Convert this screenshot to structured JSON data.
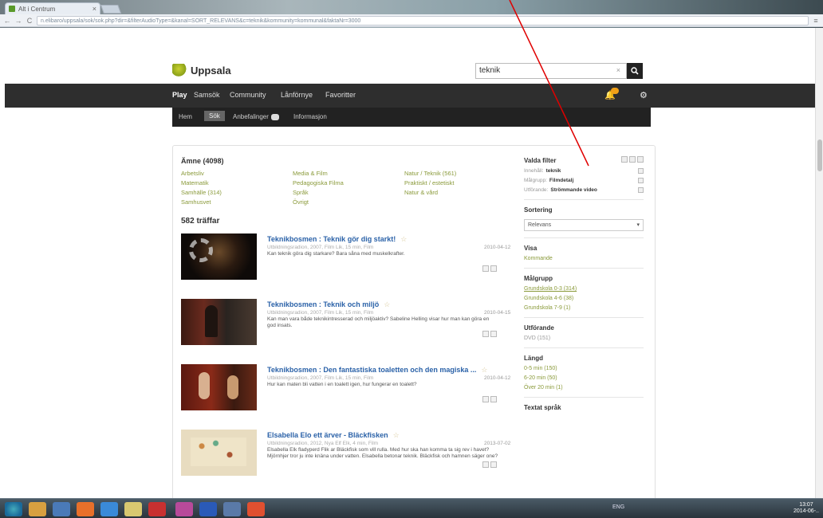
{
  "browser": {
    "tab_title": "Alt i Centrum",
    "tab_close": "×",
    "url": "n.elibaro/uppsala/sok/sok.php?dir=&filterAudioType=&kanal=SORT_RELEVANS&c=teknik&kommunity=kommunal&faktaNr=3000",
    "back": "←",
    "forward": "→",
    "reload": "C"
  },
  "header": {
    "logo_text": "Uppsala",
    "search_value": "teknik",
    "search_clear": "×",
    "search_icon": "magnifier-icon"
  },
  "nav": {
    "items": [
      "Play",
      "Samsök",
      "Community",
      "Lånförnye",
      "Favoritter"
    ],
    "subnav": [
      "Hem",
      "Sök",
      "Anbefalinger",
      "Informasjon"
    ],
    "notification_icon": "bell-icon",
    "settings_icon": "gear-icon"
  },
  "facets": {
    "heading": "Ämne (4098)",
    "items": [
      "Arbetsliv",
      "Media & Film",
      "Natur / Teknik (561)",
      "Matematik",
      "Pedagogiska Filma",
      "Praktiskt / estetiskt",
      "Samhälle (314)",
      "Språk",
      "Natur & vård",
      "Samhusvet",
      "Övrigt",
      ""
    ]
  },
  "results": {
    "count_label": "582 träffar",
    "items": [
      {
        "title": "Teknikbosmen : Teknik gör dig starkt!",
        "meta": "Utbildningsradion, 2007, Film Lik, 15 min, Film",
        "date": "2010-04-12",
        "desc": "Kan teknik göra dig starkare? Bara såna med muskelkrafter."
      },
      {
        "title": "Teknikbosmen : Teknik och miljö",
        "meta": "Utbildningsradion, 2007, Film Lik, 15 min, Film",
        "date": "2010-04-15",
        "desc": "Kan man vara både teknikintresserad och miljöaktiv? Sabeline Helling visar hur man kan göra en god insats."
      },
      {
        "title": "Teknikbosmen : Den fantastiska toaletten och den magiska ...",
        "meta": "Utbildningsradion, 2007, Film Lik, 15 min, Film",
        "date": "2010-04-12",
        "desc": "Hur kan maten bli vatten i en toalett igen, hur fungerar en toalett?"
      },
      {
        "title": "Elsabella Elo ett ärver - Bläckfisken",
        "meta": "Utbildningsradion, 2012, Nya Elf Elk, 4 min, Film",
        "date": "2013-07-02",
        "desc": "Elsabella Elk fladyperd Flik ar Bläckfisk som vill rulla. Med hur ska han komma ta sig rev i havet? Mjörnhjer tror ju inte knäna under vatten. Elsabella betonar teknik. Bläckfisk och hamnen säger one?"
      }
    ]
  },
  "sidebar": {
    "filters_heading": "Valda filter",
    "filters": [
      {
        "label": "Innehåll:",
        "value": "teknik"
      },
      {
        "label": "Målgrupp:",
        "value": "Filmdetalj"
      },
      {
        "label": "Utförande:",
        "value": "Strömmande video"
      }
    ],
    "sort_heading": "Sortering",
    "sort_value": "Relevans",
    "show_heading": "Visa",
    "show_link": "Kommande",
    "audience_heading": "Målgrupp",
    "audience_items": [
      "Grundskola 0-3 (314)",
      "Grundskola 4-6 (38)",
      "Grundskola 7-9 (1)"
    ],
    "format_heading": "Utförande",
    "format_items": [
      "DVD (151)"
    ],
    "length_heading": "Längd",
    "length_items": [
      "0-5 min (150)",
      "6-20 min (50)",
      "Över 20 min (1)"
    ],
    "lang_heading": "Textat språk"
  },
  "taskbar": {
    "clock_time": "13:07",
    "clock_date": "2014-06-..",
    "tray_label": "ENG"
  },
  "colors": {
    "nav_bg": "#2e2e2e",
    "link_blue": "#2b62a8",
    "facet_green": "#8a9a3a",
    "annotation_red": "#e00000"
  }
}
